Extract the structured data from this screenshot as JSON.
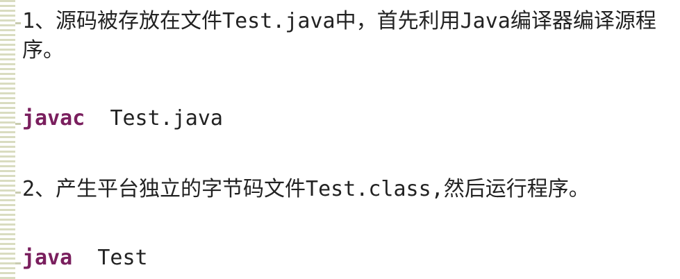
{
  "paragraphs": {
    "step1": "1、源码被存放在文件Test.java中，首先利用Java编译器编译源程序。",
    "step2": "2、产生平台独立的字节码文件Test.class,然后运行程序。"
  },
  "commands": {
    "compile_keyword": "javac",
    "compile_arg": "Test.java",
    "run_keyword": "java",
    "run_arg": "Test"
  },
  "colors": {
    "keyword": "#7a1f5e",
    "text": "#222222",
    "stripe": "#d9dcc0"
  }
}
